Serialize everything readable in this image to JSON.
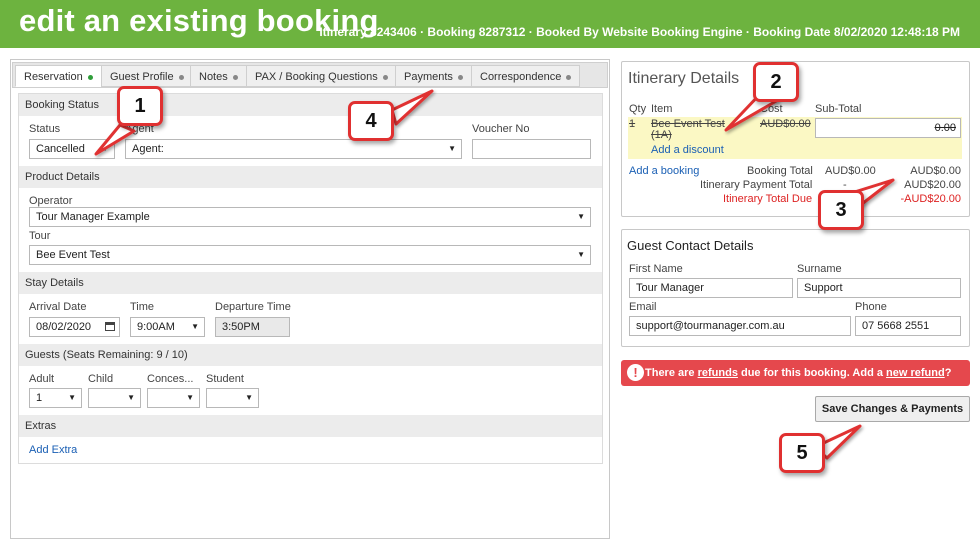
{
  "header": {
    "title": "edit an existing booking",
    "meta": "Itinerary 8243406 · Booking 8287312 · Booked By Website Booking Engine · Booking Date 8/02/2020 12:48:18 PM"
  },
  "tabs": [
    {
      "label": "Reservation",
      "dot": "green"
    },
    {
      "label": "Guest Profile",
      "dot": "grey"
    },
    {
      "label": "Notes",
      "dot": "grey"
    },
    {
      "label": "PAX / Booking Questions",
      "dot": "grey"
    },
    {
      "label": "Payments",
      "dot": "grey"
    },
    {
      "label": "Correspondence",
      "dot": "grey"
    }
  ],
  "booking_status": {
    "heading": "Booking Status",
    "status_label": "Status",
    "status_value": "Cancelled",
    "agent_label": "Agent",
    "agent_value": "Agent:",
    "voucher_label": "Voucher No",
    "voucher_value": ""
  },
  "product_details": {
    "heading": "Product Details",
    "operator_label": "Operator",
    "operator_value": "Tour Manager Example",
    "tour_label": "Tour",
    "tour_value": "Bee Event Test"
  },
  "stay_details": {
    "heading": "Stay Details",
    "arrival_label": "Arrival Date",
    "arrival_value": "08/02/2020",
    "time_label": "Time",
    "time_value": "9:00AM",
    "departure_label": "Departure Time",
    "departure_value": "3:50PM"
  },
  "guests": {
    "heading": "Guests (Seats Remaining: 9 / 10)",
    "adult_label": "Adult",
    "adult_value": "1",
    "child_label": "Child",
    "child_value": "",
    "concession_label": "Conces...",
    "concession_value": "",
    "student_label": "Student",
    "student_value": ""
  },
  "extras": {
    "heading": "Extras",
    "add_label": "Add Extra"
  },
  "itinerary": {
    "title": "Itinerary Details",
    "col_qty": "Qty",
    "col_item": "Item",
    "col_cost": "Cost",
    "col_subtotal": "Sub-Total",
    "row_qty": "1",
    "row_item": "Bee Event Test",
    "row_item_sub": "(1A)",
    "row_cost": "AUD$0.00",
    "row_subtotal": "0.00",
    "add_discount": "Add a discount",
    "add_booking": "Add a booking",
    "booking_total_label": "Booking Total",
    "booking_total_cost": "AUD$0.00",
    "booking_total_value": "AUD$0.00",
    "payment_total_label": "Itinerary Payment Total",
    "payment_total_dash": "-",
    "payment_total_value": "AUD$20.00",
    "total_due_label": "Itinerary Total Due",
    "total_due_value": "-AUD$20.00"
  },
  "guest_contact": {
    "title": "Guest Contact Details",
    "first_name_label": "First Name",
    "first_name_value": "Tour Manager",
    "surname_label": "Surname",
    "surname_value": "Support",
    "email_label": "Email",
    "email_value": "support@tourmanager.com.au",
    "phone_label": "Phone",
    "phone_value": "07 5668 2551"
  },
  "alert": {
    "icon": "!",
    "part1": "There are ",
    "refunds_link": "refunds",
    "part2": " due for this booking. Add a ",
    "new_refund_link": "new refund",
    "part3": "?"
  },
  "save_button": "Save Changes & Payments",
  "callouts": [
    "1",
    "2",
    "3",
    "4",
    "5"
  ],
  "colors": {
    "header_bg": "#6db33f",
    "alert_bg": "#e5484d",
    "callout_border": "#e03030",
    "link": "#1a5fb4",
    "highlight": "#fbf8c4"
  }
}
